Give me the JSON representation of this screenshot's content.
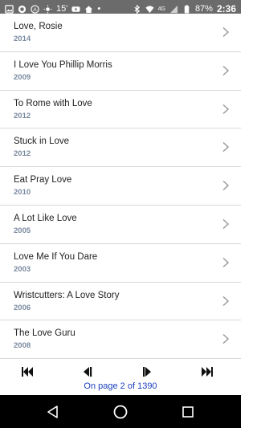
{
  "status_bar": {
    "temperature": "15'",
    "network": "4G",
    "battery": "87%",
    "time": "2:36"
  },
  "movies": [
    {
      "title": "Love, Rosie",
      "year": "2014"
    },
    {
      "title": "I Love You Phillip Morris",
      "year": "2009"
    },
    {
      "title": "To Rome with Love",
      "year": "2012"
    },
    {
      "title": "Stuck in Love",
      "year": "2012"
    },
    {
      "title": "Eat Pray Love",
      "year": "2010"
    },
    {
      "title": "A Lot Like Love",
      "year": "2005"
    },
    {
      "title": "Love Me If You Dare",
      "year": "2003"
    },
    {
      "title": "Wristcutters: A Love Story",
      "year": "2006"
    },
    {
      "title": "The Love Guru",
      "year": "2008"
    }
  ],
  "pager": {
    "text": "On page 2 of 1390"
  },
  "colors": {
    "year_text": "#7a8aa0",
    "pager_text": "#1a3fbf",
    "status_bar_bg": "#6b6b6b"
  }
}
